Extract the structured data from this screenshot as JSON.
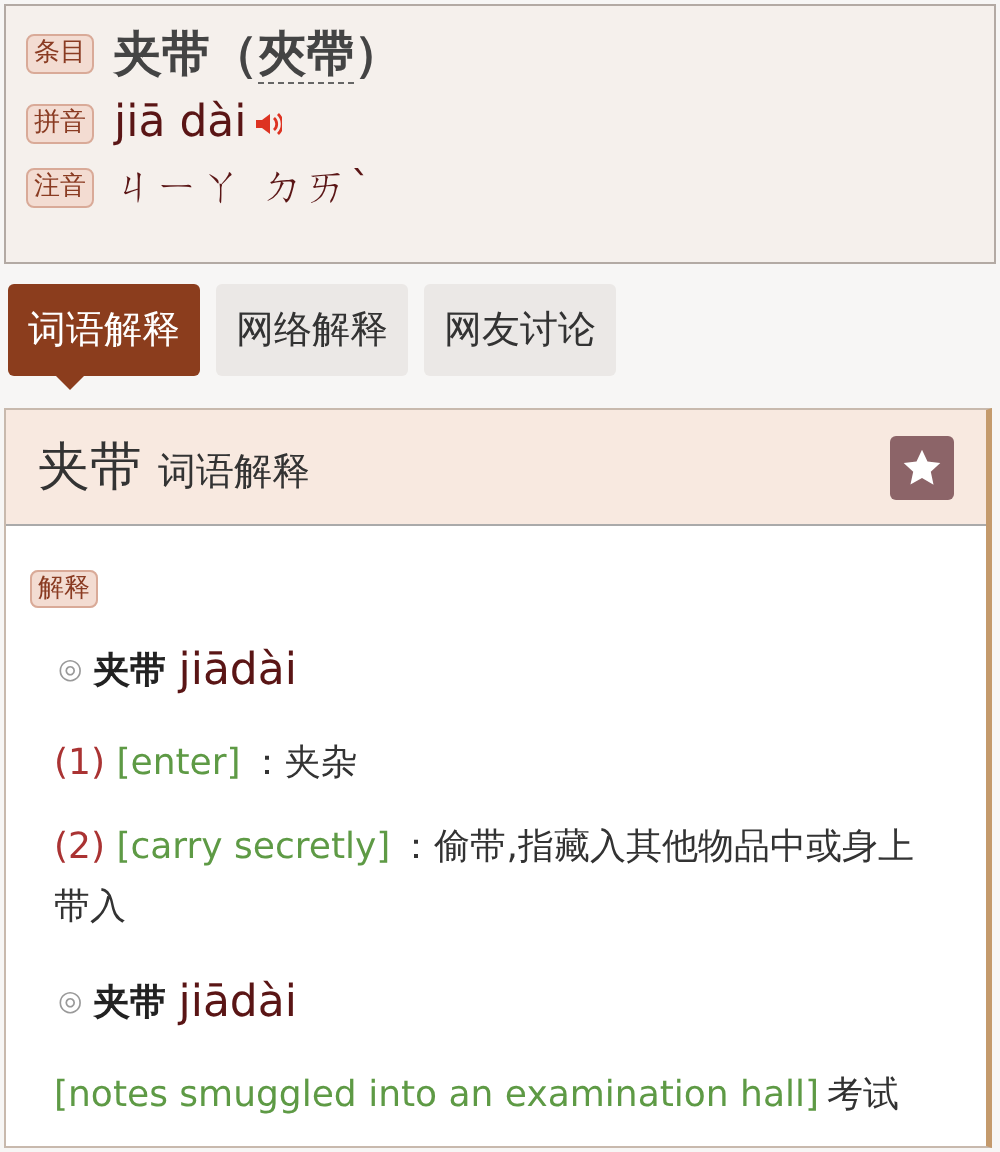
{
  "entry_header": {
    "rows": [
      {
        "kind": "title",
        "tag": "条目",
        "text": "夹带",
        "paren_open": "（",
        "traditional": "夾帶",
        "paren_close": "）"
      },
      {
        "kind": "pinyin",
        "tag": "拼音",
        "text": "jiā dài"
      },
      {
        "kind": "zhuyin",
        "tag": "注音",
        "text": "ㄐㄧㄚ ㄉㄞˋ"
      }
    ]
  },
  "tabs": [
    {
      "label": "词语解释",
      "selected": true
    },
    {
      "label": "网络解释",
      "selected": false
    },
    {
      "label": "网友讨论",
      "selected": false
    }
  ],
  "card": {
    "title": "夹带",
    "subtitle": "词语解释",
    "favorited": true,
    "tag": "解释",
    "entries": [
      {
        "marker": "◎",
        "headword": "夹带",
        "pinyin": "jiādài",
        "definitions": [
          {
            "number": "(1)",
            "english": "[enter]",
            "chinese": "：夹杂"
          },
          {
            "number": "(2)",
            "english": "[carry secretly]",
            "chinese": "：偷带,指藏入其他物品中或身上带入"
          }
        ]
      },
      {
        "marker": "◎",
        "headword": "夹带",
        "pinyin": "jiādài",
        "definitions": [
          {
            "english": "[notes smuggled into an examination hall]",
            "chinese": "考试"
          }
        ]
      }
    ]
  }
}
